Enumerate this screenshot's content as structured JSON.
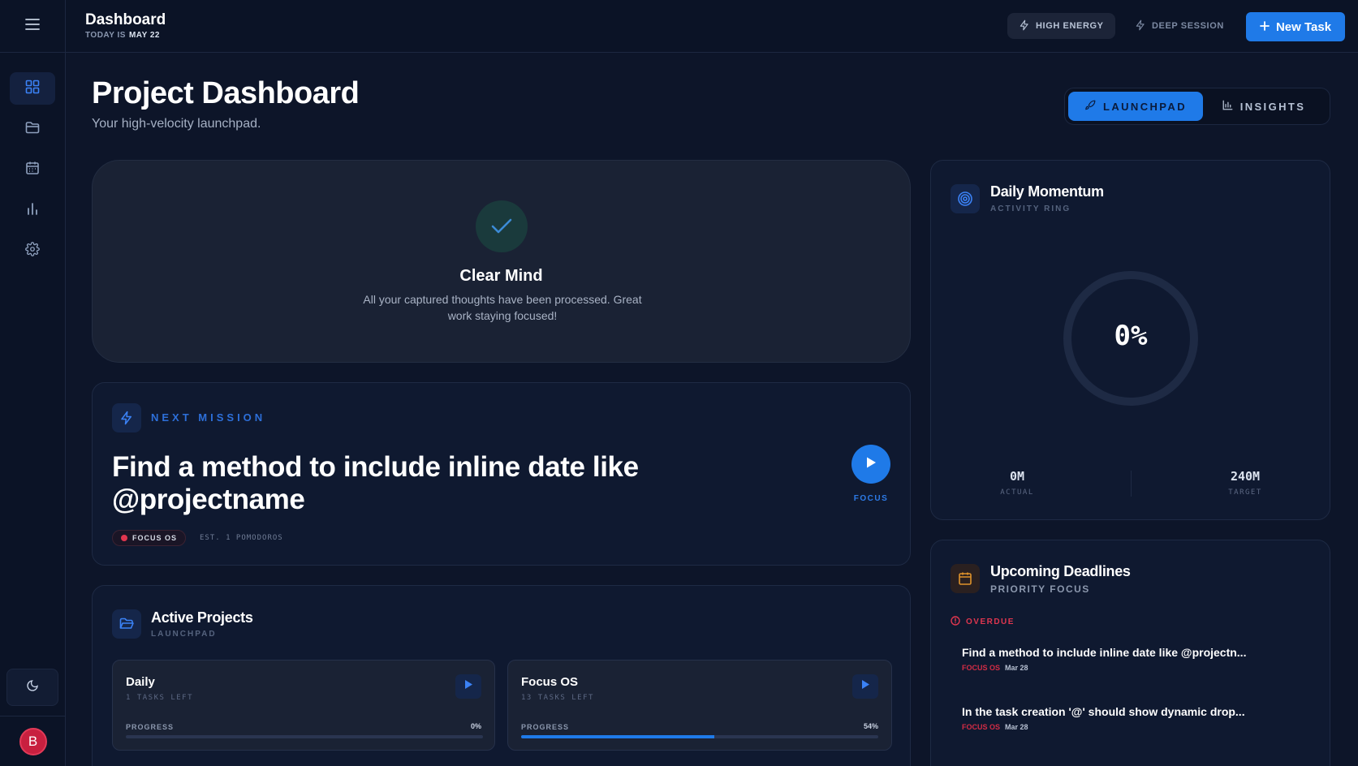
{
  "header": {
    "title": "Dashboard",
    "today_label": "TODAY IS",
    "today_date": "MAY 22",
    "chips": [
      {
        "label": "HIGH ENERGY",
        "icon": "lightning-icon"
      },
      {
        "label": "DEEP SESSION",
        "icon": "lightning-icon"
      }
    ],
    "new_task_label": "New Task"
  },
  "sidebar": {
    "items": [
      {
        "name": "dashboard",
        "icon": "grid-icon",
        "active": true
      },
      {
        "name": "projects",
        "icon": "folder-icon",
        "active": false
      },
      {
        "name": "calendar",
        "icon": "calendar-icon",
        "active": false
      },
      {
        "name": "insights",
        "icon": "bar-chart-icon",
        "active": false
      },
      {
        "name": "settings",
        "icon": "gear-icon",
        "active": false
      }
    ],
    "avatar_initial": "B"
  },
  "page": {
    "title": "Project Dashboard",
    "subtitle": "Your high-velocity launchpad.",
    "tabs": [
      {
        "label": "LAUNCHPAD",
        "active": true
      },
      {
        "label": "INSIGHTS",
        "active": false
      }
    ]
  },
  "clear_mind": {
    "title": "Clear Mind",
    "text": "All your captured thoughts have been processed. Great work staying focused!"
  },
  "next_mission": {
    "label": "NEXT MISSION",
    "title": "Find a method to include inline date like @projectname",
    "project_tag": "FOCUS OS",
    "estimate": "EST. 1 POMODOROS",
    "focus_label": "FOCUS"
  },
  "active_projects": {
    "title": "Active Projects",
    "subtitle": "LAUNCHPAD",
    "progress_label": "PROGRESS",
    "projects": [
      {
        "name": "Daily",
        "tasks_left": "1 TASKS LEFT",
        "progress_text": "0%",
        "progress": 0
      },
      {
        "name": "Focus OS",
        "tasks_left": "13 TASKS LEFT",
        "progress_text": "54%",
        "progress": 54
      }
    ]
  },
  "momentum": {
    "title": "Daily Momentum",
    "subtitle": "ACTIVITY RING",
    "percent_text": "0%",
    "percent": 0,
    "actual_value": "0M",
    "actual_label": "ACTUAL",
    "target_value": "240M",
    "target_label": "TARGET"
  },
  "deadlines": {
    "title": "Upcoming Deadlines",
    "subtitle": "PRIORITY FOCUS",
    "overdue_label": "OVERDUE",
    "items": [
      {
        "title": "Find a method to include inline date like @projectn...",
        "project": "FOCUS OS",
        "date": "Mar 28"
      },
      {
        "title": "In the task creation '@' should show dynamic drop...",
        "project": "FOCUS OS",
        "date": "Mar 28"
      }
    ]
  },
  "colors": {
    "accent": "#1f7ae8",
    "background": "#0d1529",
    "overdue": "#e0364f"
  }
}
